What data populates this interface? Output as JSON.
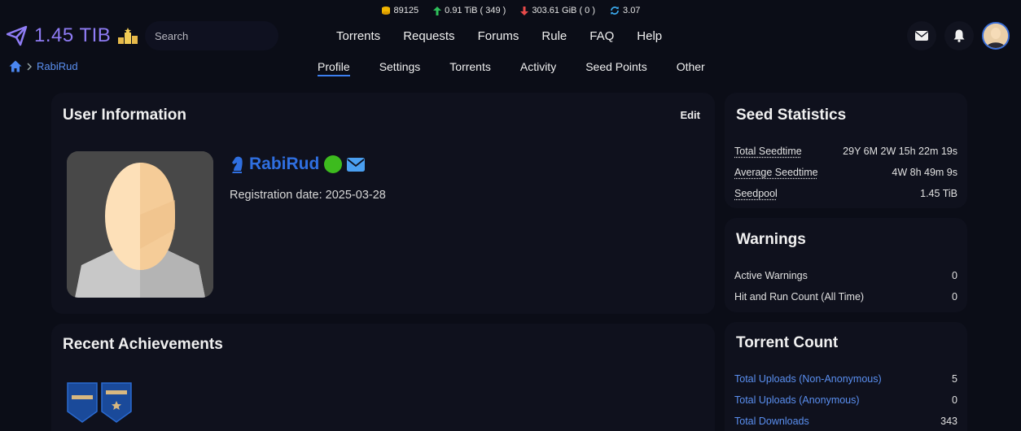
{
  "stats": {
    "bonus": "89125",
    "upload": "0.91 TiB ( 349 )",
    "download": "303.61 GiB ( 0 )",
    "ratio": "3.07"
  },
  "header": {
    "logo_text": "1.45 TIB",
    "search_placeholder": "Search",
    "nav": [
      "Torrents",
      "Requests",
      "Forums",
      "Rule",
      "FAQ",
      "Help"
    ]
  },
  "breadcrumb": {
    "current": "RabiRud"
  },
  "tabs": [
    "Profile",
    "Settings",
    "Torrents",
    "Activity",
    "Seed Points",
    "Other"
  ],
  "user_info": {
    "title": "User Information",
    "edit_label": "Edit",
    "username": "RabiRud",
    "registration": "Registration date: 2025-03-28"
  },
  "achievements": {
    "title": "Recent Achievements"
  },
  "seed_stats": {
    "title": "Seed Statistics",
    "rows": [
      {
        "label": "Total Seedtime",
        "value": "29Y 6M 2W 15h 22m 19s"
      },
      {
        "label": "Average Seedtime",
        "value": "4W 8h 49m 9s"
      },
      {
        "label": "Seedpool",
        "value": "1.45 TiB"
      }
    ]
  },
  "warnings": {
    "title": "Warnings",
    "rows": [
      {
        "label": "Active Warnings",
        "value": "0"
      },
      {
        "label": "Hit and Run Count (All Time)",
        "value": "0"
      }
    ]
  },
  "torrent_count": {
    "title": "Torrent Count",
    "rows": [
      {
        "label": "Total Uploads (Non-Anonymous)",
        "value": "5"
      },
      {
        "label": "Total Uploads (Anonymous)",
        "value": "0"
      },
      {
        "label": "Total Downloads",
        "value": "343"
      }
    ]
  },
  "colors": {
    "accent": "#3b7ef0",
    "logo": "#8f7cf5",
    "online": "#3dbb1e",
    "background": "#0b0d17",
    "card": "#0f111d"
  }
}
